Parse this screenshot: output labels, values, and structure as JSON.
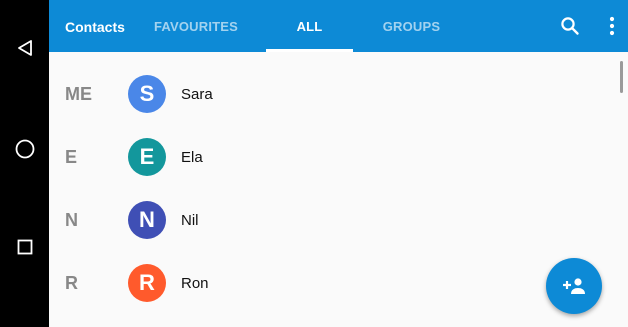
{
  "system_nav": {
    "back_icon": "back-triangle-icon",
    "home_icon": "home-circle-icon",
    "recents_icon": "recents-square-icon"
  },
  "appbar": {
    "title": "Contacts",
    "tabs": [
      {
        "label": "FAVOURITES",
        "active": false
      },
      {
        "label": "ALL",
        "active": true
      },
      {
        "label": "GROUPS",
        "active": false
      }
    ],
    "search_icon": "search-icon",
    "menu_icon": "more-vert-icon",
    "color": "#0d8ad6"
  },
  "contacts": [
    {
      "section": "ME",
      "initial": "S",
      "name": "Sara",
      "color": "#4a87e8"
    },
    {
      "section": "E",
      "initial": "E",
      "name": "Ela",
      "color": "#13979c"
    },
    {
      "section": "N",
      "initial": "N",
      "name": "Nil",
      "color": "#3f4fb5"
    },
    {
      "section": "R",
      "initial": "R",
      "name": "Ron",
      "color": "#ff5a2c"
    }
  ],
  "fab": {
    "icon": "add-contact-icon",
    "color": "#0d8ad6"
  }
}
